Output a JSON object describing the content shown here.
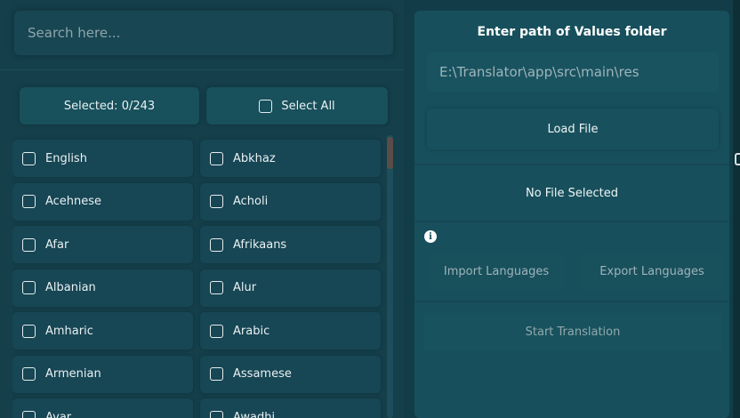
{
  "search": {
    "placeholder": "Search here..."
  },
  "selection": {
    "selected_label": "Selected: 0/243",
    "select_all_label": "Select All"
  },
  "languages": [
    "English",
    "Abkhaz",
    "Acehnese",
    "Acholi",
    "Afar",
    "Afrikaans",
    "Albanian",
    "Alur",
    "Amharic",
    "Arabic",
    "Armenian",
    "Assamese",
    "Avar",
    "Awadhi"
  ],
  "right_panel": {
    "title": "Enter path of Values folder",
    "path_value": "E:\\Translator\\app\\src\\main\\res",
    "load_label": "Load File",
    "file_status": "No File Selected",
    "import_label": "Import Languages",
    "export_label": "Export Languages",
    "start_label": "Start Translation"
  },
  "icons": {
    "info": "info-icon",
    "checkbox": "checkbox-icon"
  },
  "colors": {
    "background": "#133f4a",
    "panel": "#17505c",
    "scroll_thumb": "#5a4c47"
  }
}
